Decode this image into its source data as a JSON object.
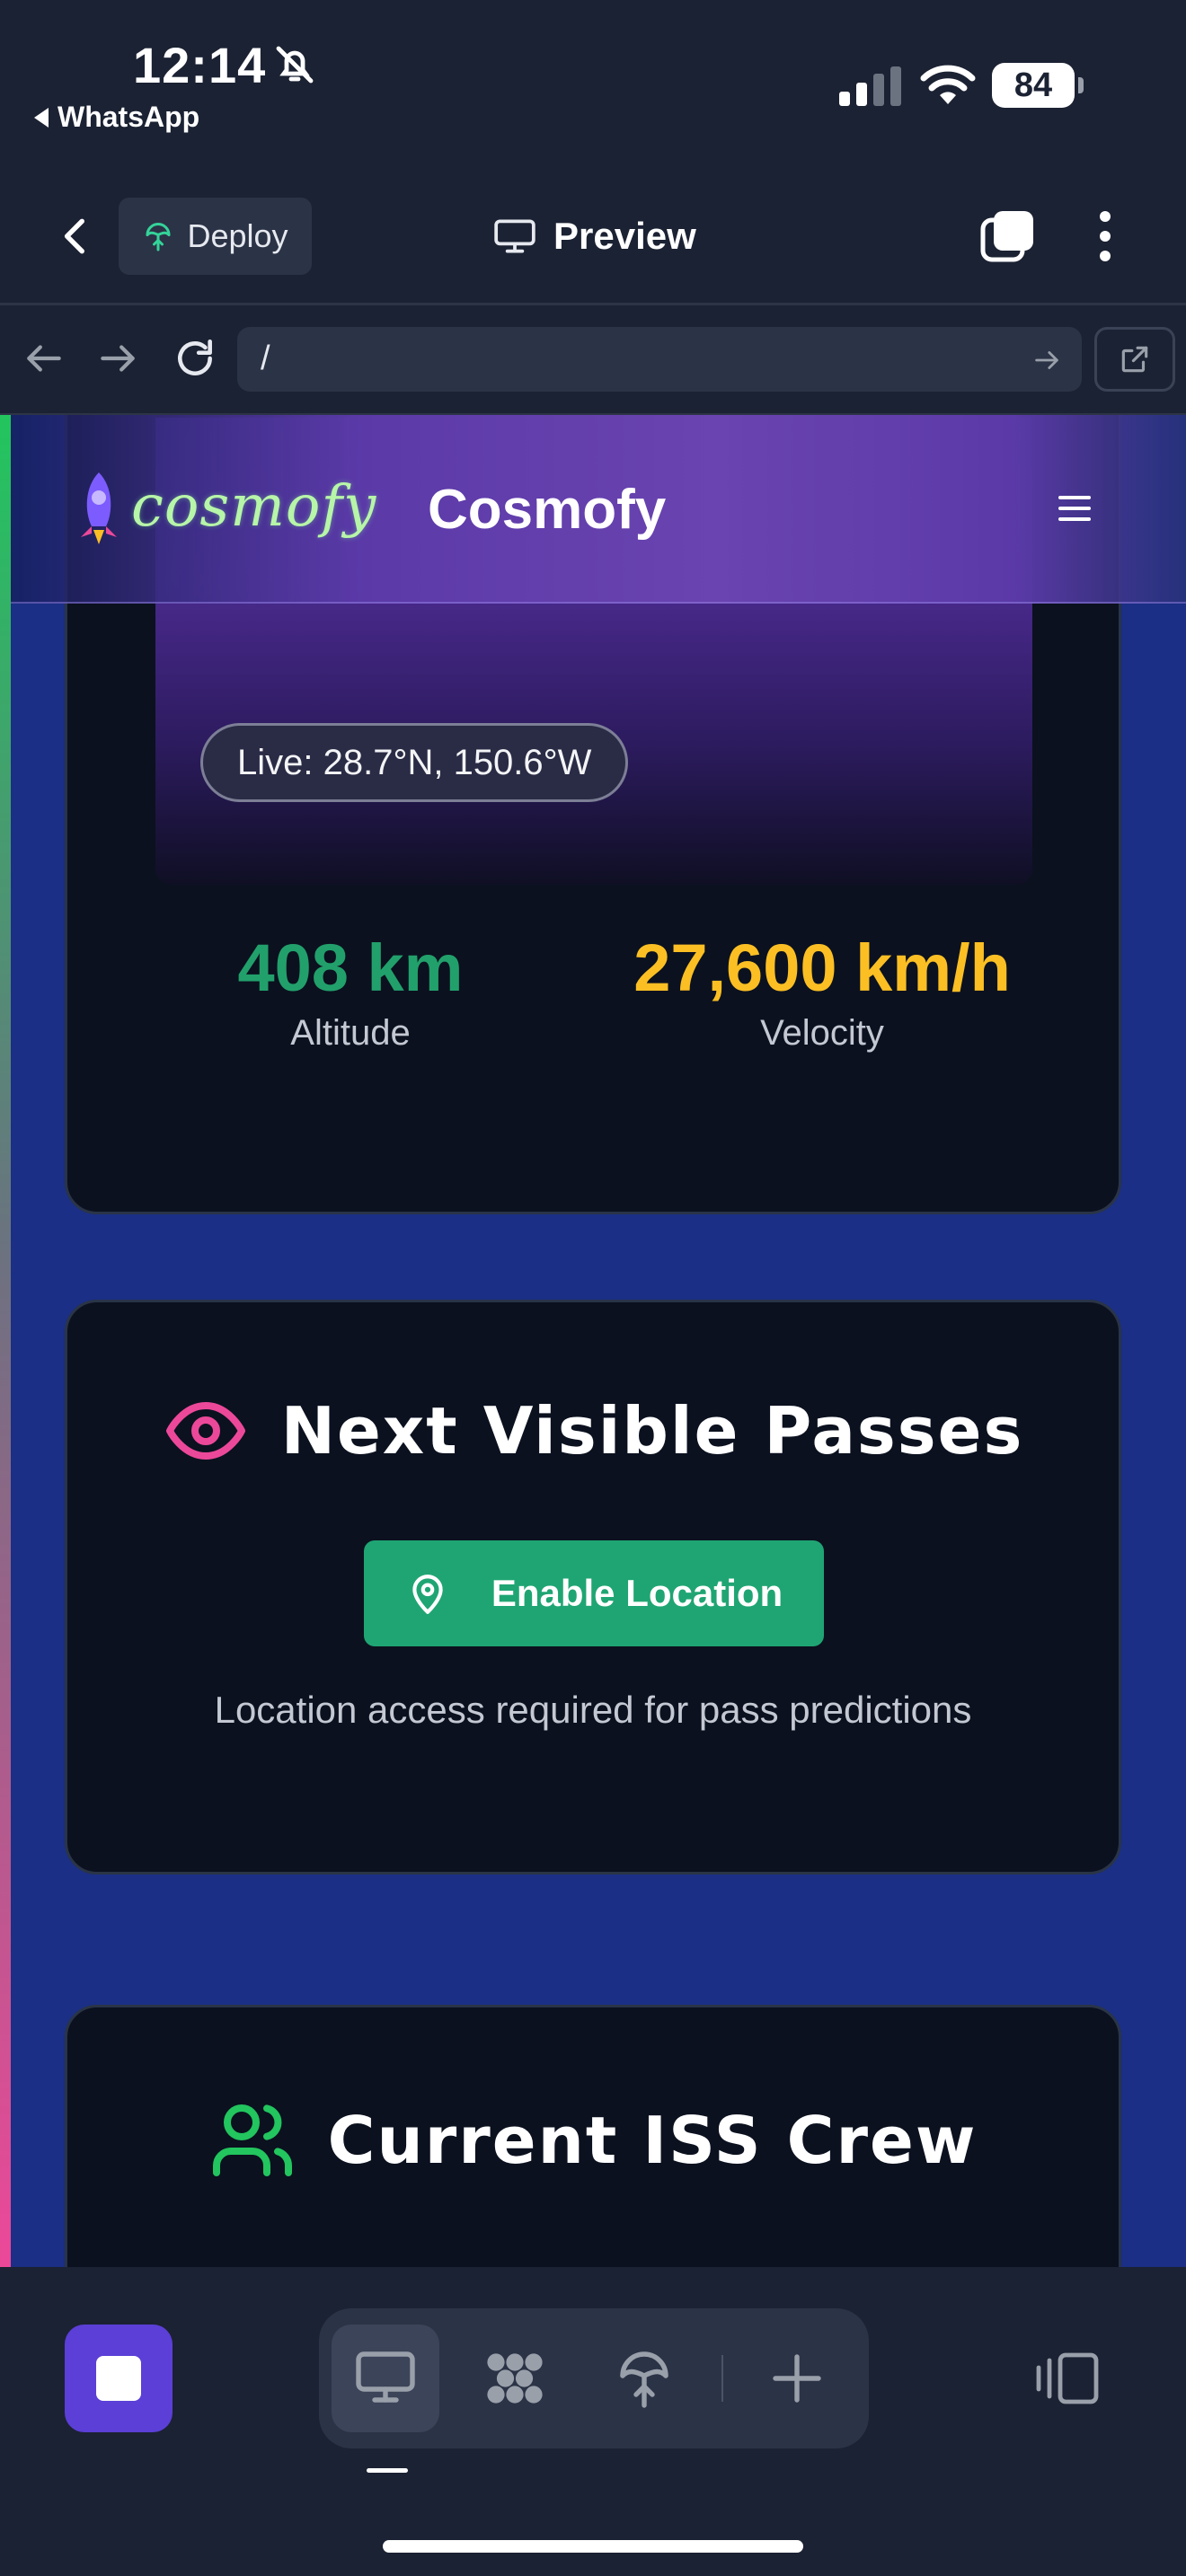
{
  "status_bar": {
    "time": "12:14",
    "back_app": "WhatsApp",
    "battery": "84",
    "icons": [
      "bell-slash-icon",
      "signal-icon",
      "wifi-icon",
      "battery-icon"
    ]
  },
  "app_bar": {
    "deploy_label": "Deploy",
    "preview_label": "Preview",
    "icons": [
      "back-icon",
      "deploy-icon",
      "monitor-icon",
      "tabs-icon",
      "more-icon"
    ]
  },
  "browser_bar": {
    "url": "/",
    "icons": [
      "nav-back-icon",
      "nav-forward-icon",
      "reload-icon",
      "go-icon",
      "open-external-icon"
    ]
  },
  "site": {
    "logo_text": "cosmofy",
    "title": "Cosmofy",
    "menu_icon": "hamburger-icon"
  },
  "tracker": {
    "live_label": "Live: 28.7°N, 150.6°W",
    "altitude_value": "408 km",
    "altitude_label": "Altitude",
    "velocity_value": "27,600 km/h",
    "velocity_label": "Velocity"
  },
  "passes": {
    "title": "Next Visible Passes",
    "button_label": "Enable Location",
    "note": "Location access required for pass predictions",
    "icons": [
      "eye-icon",
      "map-pin-icon"
    ]
  },
  "crew": {
    "title": "Current ISS Crew",
    "icon": "users-icon"
  },
  "bottom_bar": {
    "icons": [
      "stop-icon",
      "monitor-icon",
      "shapes-icon",
      "deploy-icon",
      "plus-icon",
      "split-view-icon"
    ],
    "active_tool": "monitor"
  },
  "colors": {
    "accent_green": "#1fa573",
    "altitude_green": "#22a06b",
    "velocity_amber": "#fbbf24",
    "eye_pink": "#ec4899",
    "page_blue": "#1a2f85",
    "card_bg": "#0b111f",
    "stop_purple": "#5b3fd6"
  }
}
